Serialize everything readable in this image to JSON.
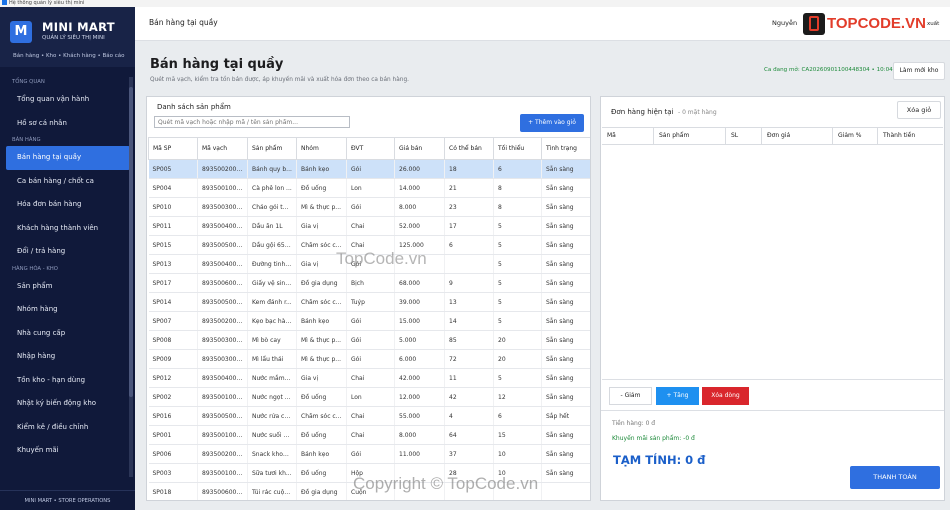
{
  "window": {
    "title": "Hệ thống quản lý siêu thị mini"
  },
  "sidebar": {
    "logo_letter": "M",
    "brand_title": "MINI MART",
    "brand_subtitle": "QUẢN LÝ SIÊU THỊ MINI",
    "brand_nav": "Bán hàng • Kho • Khách hàng • Báo cáo",
    "sections": [
      {
        "title": "TỔNG QUAN",
        "items": [
          "Tổng quan vận hành",
          "Hồ sơ cá nhân"
        ]
      },
      {
        "title": "BÁN HÀNG",
        "items": [
          "Bán hàng tại quầy",
          "Ca bán hàng / chốt ca",
          "Hóa đơn bán hàng",
          "Khách hàng thành viên",
          "Đổi / trả hàng"
        ]
      },
      {
        "title": "HÀNG HÓA - KHO",
        "items": [
          "Sản phẩm",
          "Nhóm hàng",
          "Nhà cung cấp",
          "Nhập hàng",
          "Tồn kho - hạn dùng",
          "Nhật ký biến động kho",
          "Kiểm kê / điều chỉnh",
          "Khuyến mãi"
        ]
      }
    ],
    "active_item": "Bán hàng tại quầy",
    "footer": "MINI MART • STORE OPERATIONS"
  },
  "header": {
    "title": "Bán hàng tại quầy",
    "user": "Nguyễn",
    "logout": "xuất"
  },
  "page": {
    "title": "Bán hàng tại quầy",
    "description": "Quét mã vạch, kiểm tra tồn bán được, áp khuyến mãi và xuất hóa đơn theo ca bán hàng.",
    "shift": "Ca đang mở: CA20260901100448304 • 10:04",
    "refresh_button": "Làm mới kho"
  },
  "products": {
    "panel_title": "Danh sách sản phẩm",
    "search_placeholder": "Quét mã vạch hoặc nhập mã / tên sản phẩm...",
    "add_button": "+ Thêm vào giỏ",
    "columns": [
      "Mã SP",
      "Mã vạch",
      "Sản phẩm",
      "Nhóm",
      "ĐVT",
      "Giá bán",
      "Có thể bán",
      "Tối thiểu",
      "Tình trạng"
    ],
    "rows": [
      [
        "SP005",
        "8935002000...",
        "Bánh quy b...",
        "Bánh kẹo",
        "Gói",
        "26.000",
        "18",
        "6",
        "Sẵn sàng"
      ],
      [
        "SP004",
        "8935001000...",
        "Cà phê lon ...",
        "Đồ uống",
        "Lon",
        "14.000",
        "21",
        "8",
        "Sẵn sàng"
      ],
      [
        "SP010",
        "8935003000...",
        "Cháo gói th...",
        "Mì & thực p...",
        "Gói",
        "8.000",
        "23",
        "8",
        "Sẵn sàng"
      ],
      [
        "SP011",
        "8935004000...",
        "Dầu ăn 1L",
        "Gia vị",
        "Chai",
        "52.000",
        "17",
        "5",
        "Sẵn sàng"
      ],
      [
        "SP015",
        "8935005000...",
        "Dầu gội 650g",
        "Chăm sóc c...",
        "Chai",
        "125.000",
        "6",
        "5",
        "Sẵn sàng"
      ],
      [
        "SP013",
        "8935004000...",
        "Đường tinh ...",
        "Gia vị",
        "Gói",
        "",
        "",
        "5",
        "Sẵn sàng"
      ],
      [
        "SP017",
        "8935006000...",
        "Giấy vệ sinh...",
        "Đồ gia dụng",
        "Bịch",
        "68.000",
        "9",
        "5",
        "Sẵn sàng"
      ],
      [
        "SP014",
        "8935005000...",
        "Kem đánh r...",
        "Chăm sóc c...",
        "Tuýp",
        "39.000",
        "13",
        "5",
        "Sẵn sàng"
      ],
      [
        "SP007",
        "8935002000...",
        "Kẹo bạc hà ...",
        "Bánh kẹo",
        "Gói",
        "15.000",
        "14",
        "5",
        "Sẵn sàng"
      ],
      [
        "SP008",
        "8935003000...",
        "Mì bò cay",
        "Mì & thực p...",
        "Gói",
        "5.000",
        "85",
        "20",
        "Sẵn sàng"
      ],
      [
        "SP009",
        "8935003000...",
        "Mì lẩu thái",
        "Mì & thực p...",
        "Gói",
        "6.000",
        "72",
        "20",
        "Sẵn sàng"
      ],
      [
        "SP012",
        "8935004000...",
        "Nước mắm ...",
        "Gia vị",
        "Chai",
        "42.000",
        "11",
        "5",
        "Sẵn sàng"
      ],
      [
        "SP002",
        "8935001000...",
        "Nước ngọt ...",
        "Đồ uống",
        "Lon",
        "12.000",
        "42",
        "12",
        "Sẵn sàng"
      ],
      [
        "SP016",
        "8935005000...",
        "Nước rửa ch...",
        "Chăm sóc c...",
        "Chai",
        "55.000",
        "4",
        "6",
        "Sắp hết"
      ],
      [
        "SP001",
        "8935001000...",
        "Nước suối 5...",
        "Đồ uống",
        "Chai",
        "8.000",
        "64",
        "15",
        "Sẵn sàng"
      ],
      [
        "SP006",
        "8935002000...",
        "Snack khoai...",
        "Bánh kẹo",
        "Gói",
        "11.000",
        "37",
        "10",
        "Sẵn sàng"
      ],
      [
        "SP003",
        "8935001000...",
        "Sữa tươi kh...",
        "Đồ uống",
        "Hộp",
        "",
        "28",
        "10",
        "Sẵn sàng"
      ],
      [
        "SP018",
        "8935006000...",
        "Túi rác cuộn...",
        "Đồ gia dụng",
        "Cuộn",
        "",
        "",
        "",
        ""
      ]
    ]
  },
  "cart": {
    "title": "Đơn hàng hiện tại",
    "count": "- 0 mặt hàng",
    "clear_button": "Xóa giỏ",
    "columns": [
      "Mã",
      "Sản phẩm",
      "SL",
      "Đơn giá",
      "Giảm %",
      "Thành tiền"
    ],
    "minus_button": "- Giảm",
    "plus_button": "+ Tăng",
    "delete_button": "Xóa dòng",
    "goods_total": "Tiền hàng: 0 đ",
    "promo": "Khuyến mãi sản phẩm: -0 đ",
    "subtotal": "TẠM TÍNH: 0 đ",
    "pay_button": "THANH TOÁN"
  },
  "watermarks": {
    "logo_text": "TOPCODE.VN",
    "center": "TopCode.vn",
    "bottom": "Copyright © TopCode.vn"
  }
}
